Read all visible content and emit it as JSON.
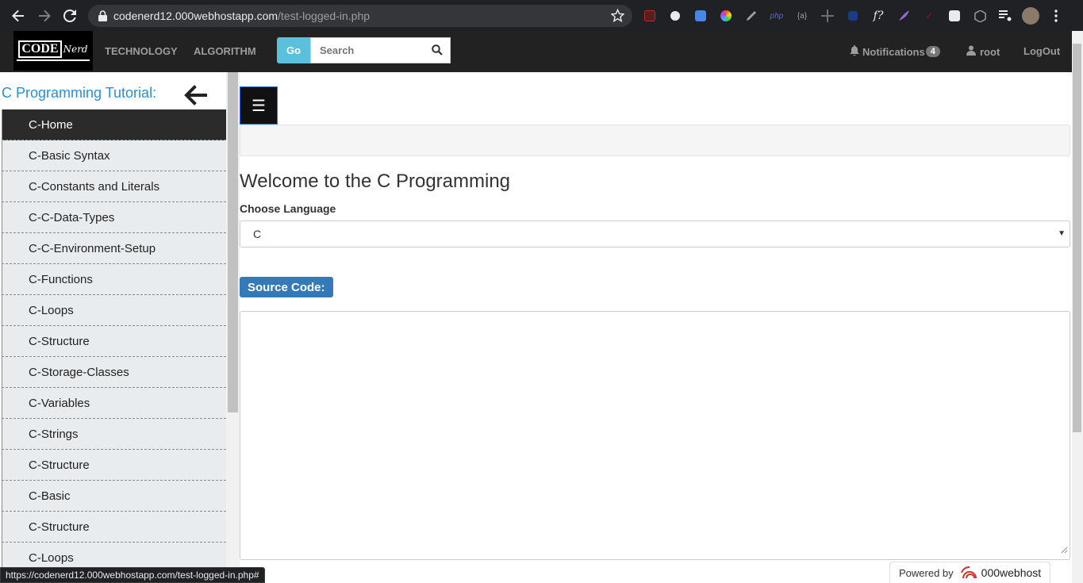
{
  "browser": {
    "url_host": "codenerd12.000webhostapp.com",
    "url_path": "/test-logged-in.php",
    "status_url": "https://codenerd12.000webhostapp.com/test-logged-in.php#"
  },
  "navbar": {
    "logo_code": "CODE",
    "logo_nerd": "Nerd",
    "links": [
      "TECHNOLOGY",
      "ALGORITHM"
    ],
    "go_label": "Go",
    "search_placeholder": "Search",
    "notifications_label": "Notifications",
    "notifications_count": "4",
    "user_label": "root",
    "logout_label": "LogOut"
  },
  "sidebar": {
    "title": "C Programming Tutorial:",
    "items": [
      "C-Home",
      "C-Basic Syntax",
      "C-Constants and Literals",
      "C-C-Data-Types",
      "C-C-Environment-Setup",
      "C-Functions",
      "C-Loops",
      "C-Structure",
      "C-Storage-Classes",
      "C-Variables",
      "C-Strings",
      "C-Structure",
      "C-Basic",
      "C-Structure",
      "C-Loops"
    ],
    "active_index": 0
  },
  "main": {
    "menu_icon": "☰",
    "heading": "Welcome to the C Programming",
    "choose_label": "Choose Language",
    "selected_language": "C",
    "source_label": "Source Code:",
    "source_value": ""
  },
  "footer": {
    "powered_by": "Powered by",
    "brand": "000webhost"
  },
  "colors": {
    "navbar_bg": "#222222",
    "accent_blue": "#337ab7",
    "go_button": "#5bc0de",
    "sidebar_title": "#2b8fd6",
    "sidebar_active": "#2b2b2b"
  }
}
